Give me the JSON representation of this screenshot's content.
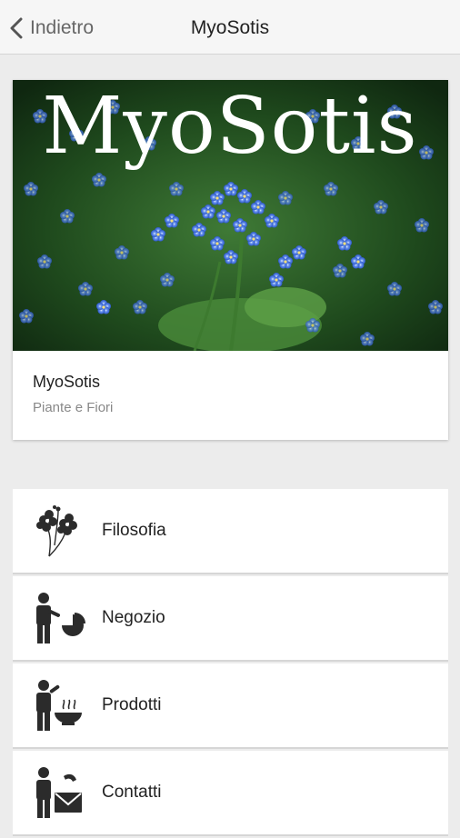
{
  "header": {
    "back_label": "Indietro",
    "title": "MyoSotis"
  },
  "card": {
    "banner_text": "MyoSotis",
    "title": "MyoSotis",
    "subtitle": "Piante e Fiori"
  },
  "menu": {
    "items": [
      {
        "label": "Filosofia",
        "icon": "flowers-icon"
      },
      {
        "label": "Negozio",
        "icon": "person-chart-icon"
      },
      {
        "label": "Prodotti",
        "icon": "person-bowl-icon"
      },
      {
        "label": "Contatti",
        "icon": "person-mail-icon"
      }
    ]
  },
  "colors": {
    "accent_blue": "#3d6fd8",
    "leaf_green": "#2f6a2a",
    "icon_dark": "#2b2b2b"
  }
}
